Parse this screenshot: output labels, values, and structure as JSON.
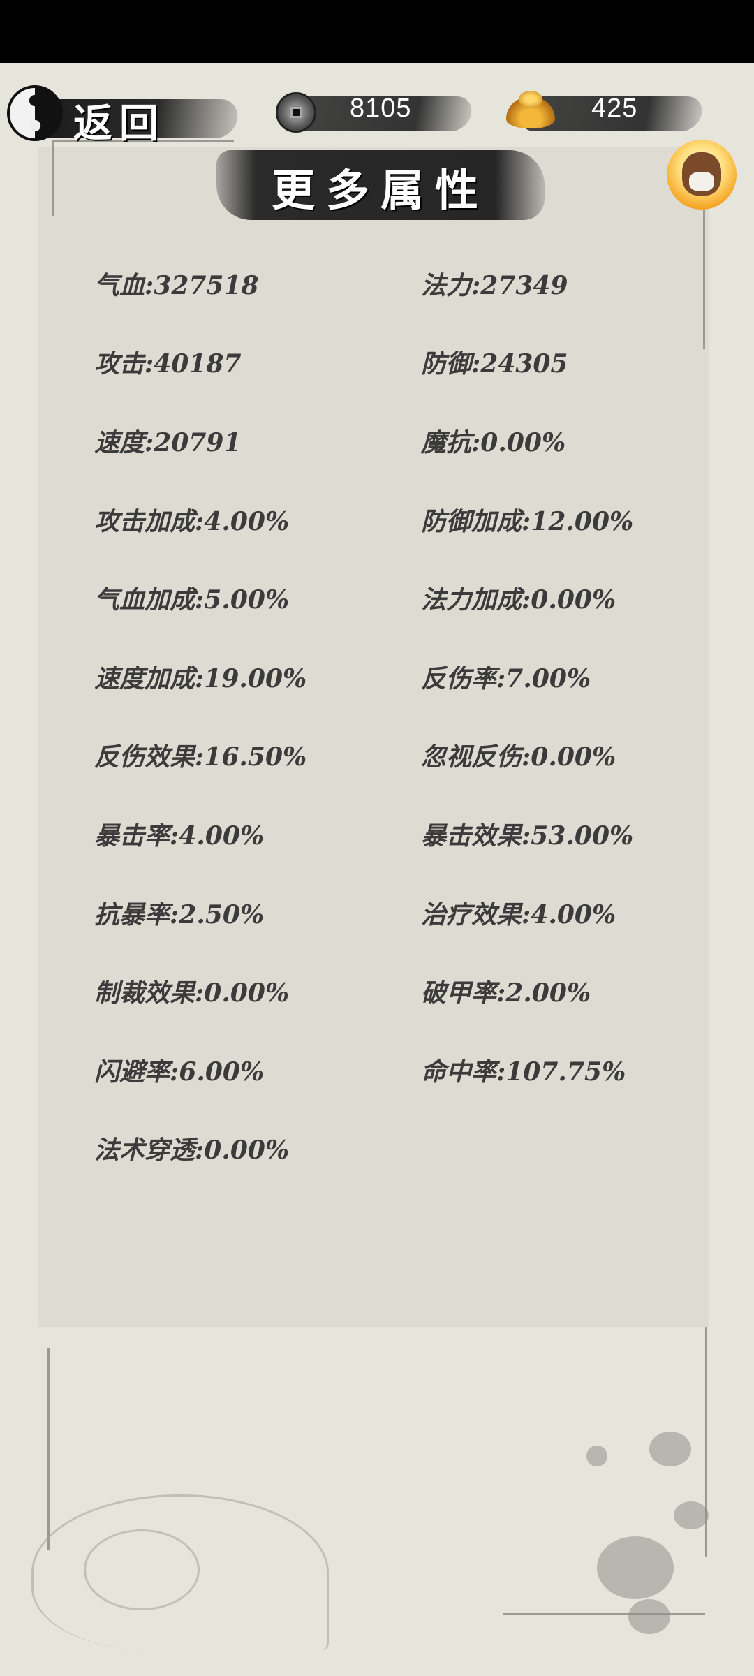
{
  "top_bar": {
    "back_label": "返回",
    "coins": "8105",
    "ingots": "425"
  },
  "page_title": "更多属性",
  "stats": [
    {
      "label": "气血:327518"
    },
    {
      "label": "法力:27349"
    },
    {
      "label": "攻击:40187"
    },
    {
      "label": "防御:24305"
    },
    {
      "label": "速度:20791"
    },
    {
      "label": "魔抗:0.00%"
    },
    {
      "label": "攻击加成:4.00%"
    },
    {
      "label": "防御加成:12.00%"
    },
    {
      "label": "气血加成:5.00%"
    },
    {
      "label": "法力加成:0.00%"
    },
    {
      "label": "速度加成:19.00%"
    },
    {
      "label": "反伤率:7.00%"
    },
    {
      "label": "反伤效果:16.50%"
    },
    {
      "label": "忽视反伤:0.00%"
    },
    {
      "label": "暴击率:4.00%"
    },
    {
      "label": "暴击效果:53.00%"
    },
    {
      "label": "抗暴率:2.50%"
    },
    {
      "label": "治疗效果:4.00%"
    },
    {
      "label": "制裁效果:0.00%"
    },
    {
      "label": "破甲率:2.00%"
    },
    {
      "label": "闪避率:6.00%"
    },
    {
      "label": "命中率:107.75%"
    },
    {
      "label": "法术穿透:0.00%"
    }
  ]
}
